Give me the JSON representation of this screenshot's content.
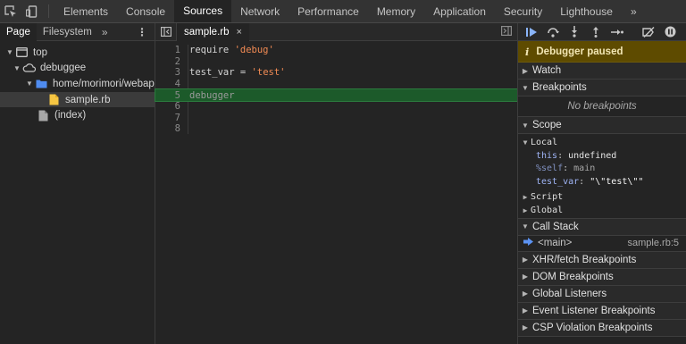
{
  "topbar": {
    "tabs": [
      "Elements",
      "Console",
      "Sources",
      "Network",
      "Performance",
      "Memory",
      "Application",
      "Security",
      "Lighthouse"
    ],
    "active_tab": "Sources",
    "more_label": "»"
  },
  "navigator": {
    "tabs": [
      "Page",
      "Filesystem"
    ],
    "more_label": "»",
    "tree": [
      {
        "label": "top",
        "icon": "frame-icon"
      },
      {
        "label": "debuggee",
        "icon": "cloud-icon"
      },
      {
        "label": "home/morimori/webapp",
        "icon": "folder-icon"
      },
      {
        "label": "sample.rb",
        "icon": "file-icon"
      },
      {
        "label": "(index)",
        "icon": "document-icon"
      }
    ]
  },
  "editor": {
    "tab_label": "sample.rb",
    "close_label": "×",
    "lines": [
      {
        "num": "1",
        "text": "require ",
        "str": "'debug'"
      },
      {
        "num": "2",
        "text": "",
        "str": ""
      },
      {
        "num": "3",
        "text": "test_var = ",
        "str": "'test'"
      },
      {
        "num": "4",
        "text": "",
        "str": ""
      },
      {
        "num": "5",
        "text": "debugger",
        "str": ""
      },
      {
        "num": "6",
        "text": "",
        "str": ""
      },
      {
        "num": "7",
        "text": "",
        "str": ""
      },
      {
        "num": "8",
        "text": "",
        "str": ""
      }
    ]
  },
  "debugger": {
    "paused_icon": "i",
    "paused_text": "Debugger paused",
    "sections": {
      "watch": "Watch",
      "breakpoints": "Breakpoints",
      "scope": "Scope",
      "call_stack": "Call Stack",
      "xhr": "XHR/fetch Breakpoints",
      "dom": "DOM Breakpoints",
      "global_listeners": "Global Listeners",
      "event_listeners": "Event Listener Breakpoints",
      "csp": "CSP Violation Breakpoints"
    },
    "no_breakpoints": "No breakpoints",
    "scope": {
      "local_label": "Local",
      "vars": [
        {
          "name": "this",
          "value": "undefined",
          "kind": "normal"
        },
        {
          "name": "%self",
          "value": "main",
          "kind": "dim"
        },
        {
          "name": "test_var",
          "value": "\"\\\"test\\\"\"",
          "kind": "string"
        }
      ],
      "script_label": "Script",
      "global_label": "Global"
    },
    "call_stack": [
      {
        "name": "<main>",
        "location": "sample.rb:5"
      }
    ]
  },
  "colors": {
    "paused_banner": "#5e4b00",
    "exec_line": "#1c5a2a",
    "string": "#f28b54",
    "accent_blue": "#8ab4f8"
  }
}
